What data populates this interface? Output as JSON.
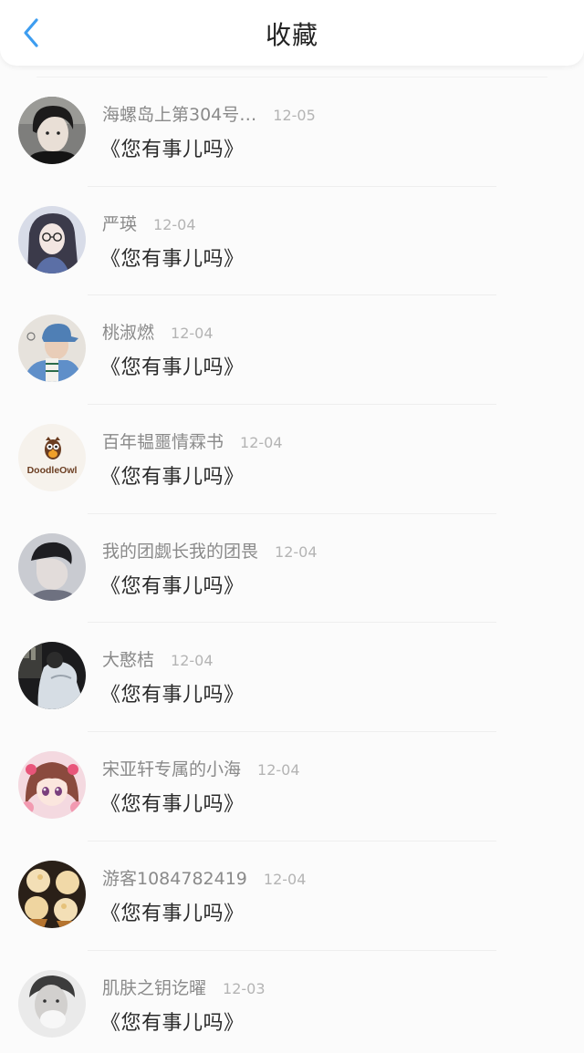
{
  "header": {
    "title": "收藏",
    "back_icon": "chevron-left-icon",
    "accent_color": "#3d9df0"
  },
  "items": [
    {
      "username": "海螺岛上第304号…",
      "date": "12-05",
      "title": "《您有事儿吗》",
      "avatar_icon": "avatar-boy-dark-hair"
    },
    {
      "username": "严瑛",
      "date": "12-04",
      "title": "《您有事儿吗》",
      "avatar_icon": "avatar-girl-glasses"
    },
    {
      "username": "桃淑燃",
      "date": "12-04",
      "title": "《您有事儿吗》",
      "avatar_icon": "avatar-boy-blue-cap"
    },
    {
      "username": "百年韫噩情霖书",
      "date": "12-04",
      "title": "《您有事儿吗》",
      "avatar_icon": "avatar-doodleowl-logo",
      "avatar_text": "DoodleOwl"
    },
    {
      "username": "我的团觑长我的团畏",
      "date": "12-04",
      "title": "《您有事儿吗》",
      "avatar_icon": "avatar-man-profile"
    },
    {
      "username": "大憨桔",
      "date": "12-04",
      "title": "《您有事儿吗》",
      "avatar_icon": "avatar-dark-photo"
    },
    {
      "username": "宋亚轩专属的小海",
      "date": "12-04",
      "title": "《您有事儿吗》",
      "avatar_icon": "avatar-anime-girl"
    },
    {
      "username": "游客1084782419",
      "date": "12-04",
      "title": "《您有事儿吗》",
      "avatar_icon": "avatar-cupcakes"
    },
    {
      "username": "肌肤之钥讫曜",
      "date": "12-03",
      "title": "《您有事儿吗》",
      "avatar_icon": "avatar-man-bw"
    }
  ]
}
